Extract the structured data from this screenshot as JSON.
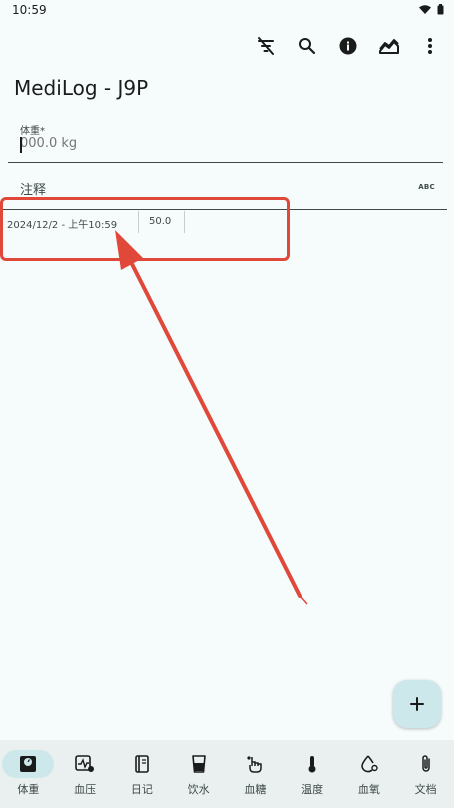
{
  "status_bar": {
    "time": "10:59"
  },
  "app": {
    "title": "MediLog - J9P"
  },
  "toolbar": {
    "icons": [
      "filter-off-icon",
      "search-icon",
      "info-icon",
      "chart-icon",
      "more-vert-icon"
    ]
  },
  "weight_field": {
    "label": "体重*",
    "placeholder": "000.0 kg"
  },
  "comment_field": {
    "label": "注释",
    "abc": "ABC"
  },
  "entries": [
    {
      "date": "2024/12/2 - 上午10:59",
      "value": "50.0"
    }
  ],
  "fab": {
    "icon": "add-icon"
  },
  "nav": {
    "items": [
      {
        "label": "体重",
        "icon": "scale-icon",
        "active": true
      },
      {
        "label": "血压",
        "icon": "blood-pressure-icon"
      },
      {
        "label": "日记",
        "icon": "diary-icon"
      },
      {
        "label": "饮水",
        "icon": "water-icon"
      },
      {
        "label": "血糖",
        "icon": "glucose-icon"
      },
      {
        "label": "温度",
        "icon": "thermometer-icon"
      },
      {
        "label": "血氧",
        "icon": "oxygen-icon"
      },
      {
        "label": "文档",
        "icon": "attachment-icon"
      }
    ]
  },
  "colors": {
    "background": "#f6fbfb",
    "accent": "#cde8ea",
    "annotation": "#e0483a",
    "nav_background": "#eaf0f0"
  }
}
